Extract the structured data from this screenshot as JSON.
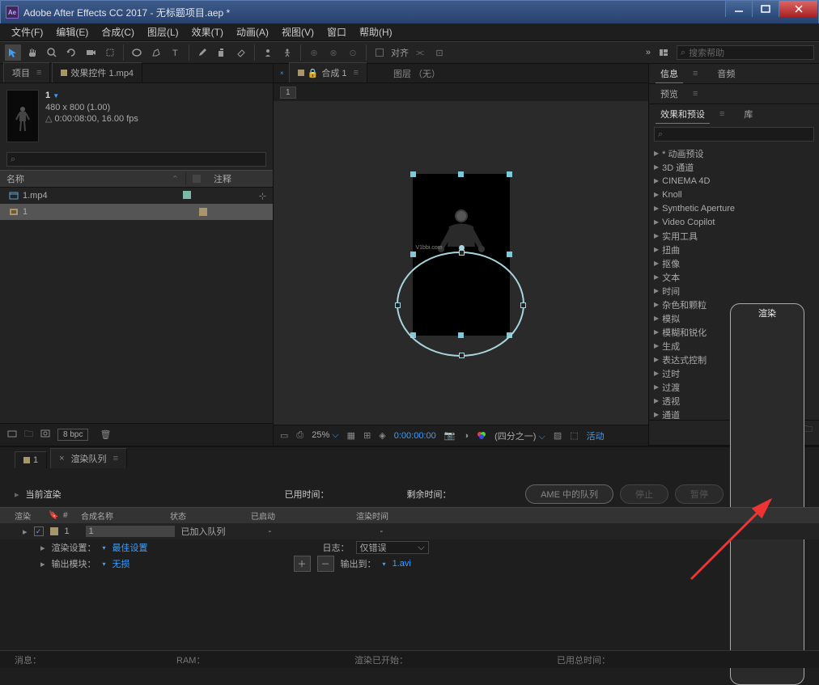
{
  "window": {
    "title": "Adobe After Effects CC 2017 - 无标题项目.aep *",
    "logo_text": "Ae"
  },
  "menu": [
    "文件(F)",
    "编辑(E)",
    "合成(C)",
    "图层(L)",
    "效果(T)",
    "动画(A)",
    "视图(V)",
    "窗口",
    "帮助(H)"
  ],
  "toolbar": {
    "align_label": "对齐",
    "search_placeholder": "搜索帮助"
  },
  "project": {
    "tab_project": "项目",
    "tab_effects": "效果控件 1.mp4",
    "item_name": "1",
    "dimensions": "480 x 800 (1.00)",
    "duration": "0:00:08:00, 16.00 fps",
    "col_name": "名称",
    "col_comment": "注释",
    "rows": [
      {
        "name": "1.mp4",
        "type": "footage"
      },
      {
        "name": "1",
        "type": "comp"
      }
    ],
    "bpc": "8 bpc"
  },
  "comp": {
    "tab_label": "合成 1",
    "layer_label": "图层 （无）",
    "layer_tag": "1",
    "zoom": "25%",
    "timecode": "0:00:00:00",
    "quality": "(四分之一)",
    "active": "活动",
    "watermark": "V1bbi.com"
  },
  "right": {
    "info": "信息",
    "audio": "音频",
    "preview": "预览",
    "effects": "效果和预设",
    "library": "库",
    "effect_list": [
      "* 动画预设",
      "3D 通道",
      "CINEMA 4D",
      "Knoll",
      "Synthetic Aperture",
      "Video Copilot",
      "实用工具",
      "扭曲",
      "抠像",
      "文本",
      "时间",
      "杂色和颗粒",
      "模拟",
      "模糊和锐化",
      "生成",
      "表达式控制",
      "过时",
      "过渡",
      "透视",
      "通道"
    ]
  },
  "render": {
    "tab_comp": "1",
    "tab_queue": "渲染队列",
    "current": "当前渲染",
    "elapsed": "已用时间：",
    "remaining": "剩余时间：",
    "ame_btn": "AME 中的队列",
    "stop_btn": "停止",
    "pause_btn": "暂停",
    "render_btn": "渲染",
    "cols": {
      "render": "渲染",
      "num": "#",
      "comp": "合成名称",
      "status": "状态",
      "started": "已启动",
      "time": "渲染时间"
    },
    "row": {
      "num": "1",
      "comp": "1",
      "status": "已加入队列",
      "started": "-",
      "time": "-"
    },
    "settings_label": "渲染设置：",
    "settings_value": "最佳设置",
    "log_label": "日志：",
    "log_value": "仅错误",
    "output_module_label": "输出模块：",
    "output_module_value": "无损",
    "output_to_label": "输出到：",
    "output_to_value": "1.avi"
  },
  "status": {
    "message": "消息：",
    "ram": "RAM：",
    "render_started": "渲染已开始：",
    "total_elapsed": "已用总时间："
  }
}
